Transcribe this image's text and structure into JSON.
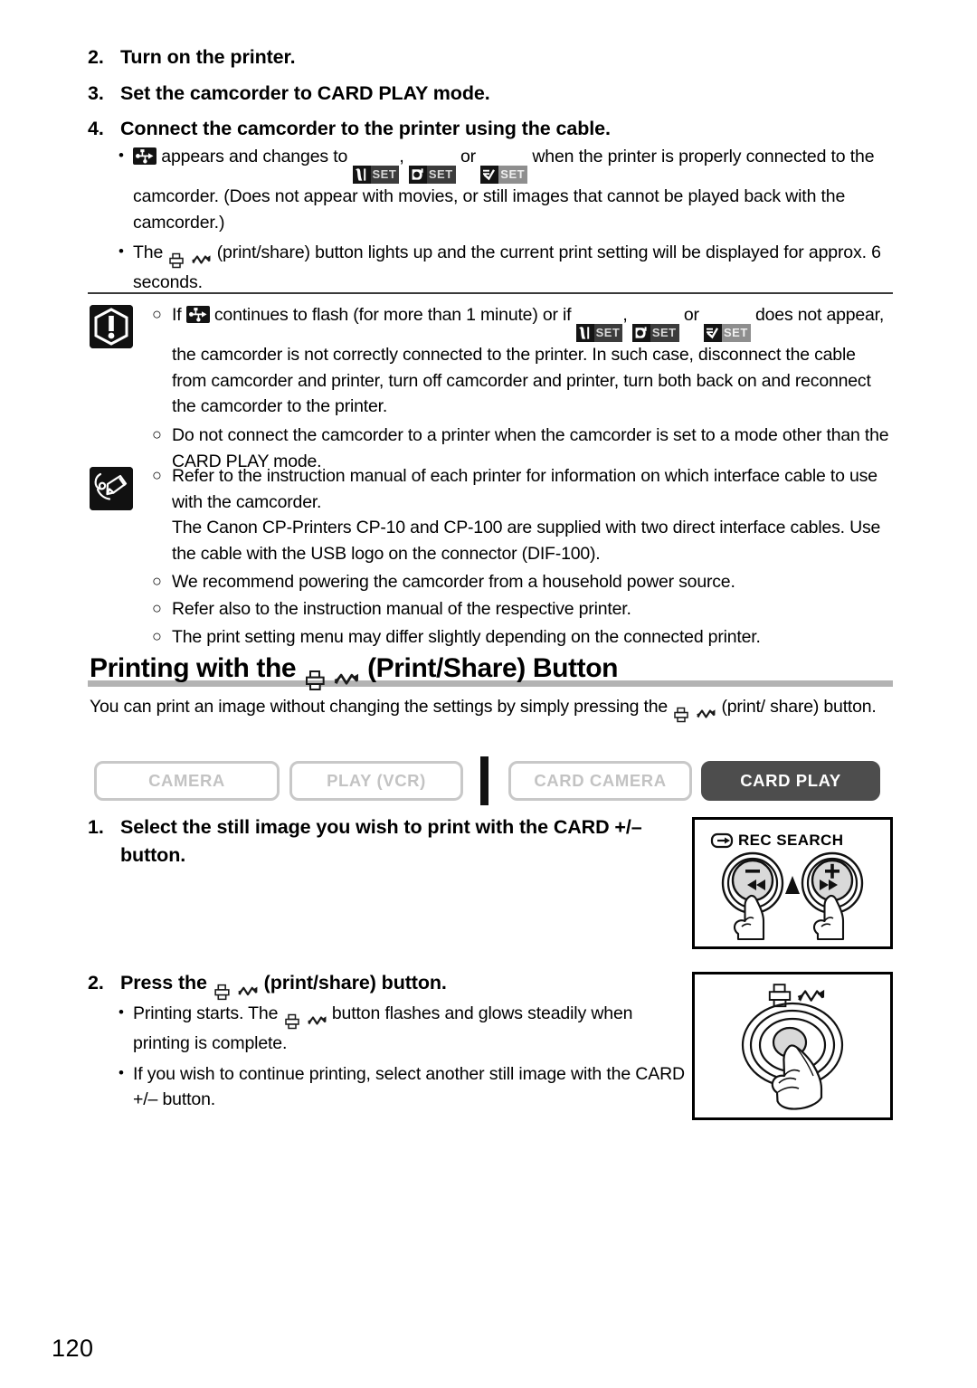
{
  "page": {
    "number": "120"
  },
  "steps_top": [
    {
      "n": "2.",
      "text": "Turn on the printer."
    },
    {
      "n": "3.",
      "text": "Set the camcorder to CARD PLAY mode."
    },
    {
      "n": "4.",
      "text": "Connect the camcorder to the printer using the cable."
    }
  ],
  "step4_bullets": [
    {
      "pre": "",
      "icon": "usb-icon",
      "mid_a": "appears and changes to",
      "badges": [
        "card-set-badge",
        "camera-set-badge",
        "check-set-badge"
      ],
      "sep1": ",",
      "sep2": "or",
      "post": "when the printer is properly connected to the camcorder. (Does not appear with movies, or still images that cannot be played back with the camcorder.)"
    },
    {
      "pre": "The",
      "icon": "print-share-icon",
      "post": "(print/share) button lights up and the current print setting will be displayed for approx. 6 seconds."
    }
  ],
  "caution": {
    "icon": "exclamation-icon",
    "items": [
      {
        "pre": "If",
        "icon": "usb-icon",
        "mid": "continues to flash (for more than 1 minute) or if",
        "badges": [
          "card-set-badge",
          "camera-set-badge",
          "check-set-badge"
        ],
        "sep1": ",",
        "sep2": "or",
        "post": "does not appear, the camcorder is not correctly connected to the printer. In such case, disconnect the cable from camcorder and printer, turn off camcorder and printer, turn both back on and reconnect the camcorder to the printer."
      },
      {
        "text": "Do not connect the camcorder to a printer when the camcorder is set to a mode other than the CARD PLAY mode."
      }
    ]
  },
  "note": {
    "icon": "pencil-note-icon",
    "items": [
      {
        "text": "Refer to the instruction manual of each printer for information on which interface cable to use with the camcorder.",
        "extra": "The Canon CP-Printers CP-10 and CP-100 are supplied with two direct interface cables. Use the cable with the USB logo on the connector (DIF-100)."
      },
      {
        "text": "We recommend powering the camcorder from a household power source."
      },
      {
        "text": "Refer also to the instruction manual of the respective printer."
      },
      {
        "text": "The print setting menu may differ slightly depending on the connected printer."
      }
    ]
  },
  "section": {
    "heading_pre": "Printing with the",
    "heading_icon": "print-share-icon",
    "heading_post": "(Print/Share) Button",
    "intro_pre": "You can print an image without changing the settings by simply pressing the",
    "intro_icon": "print-share-icon",
    "intro_post": "(print/ share) button."
  },
  "mode_tabs": [
    {
      "label": "CAMERA",
      "active": false
    },
    {
      "label": "PLAY (VCR)",
      "active": false
    },
    {
      "label": "CARD CAMERA",
      "active": false
    },
    {
      "label": "CARD PLAY",
      "active": true
    }
  ],
  "steps_body": [
    {
      "n": "1.",
      "text": "Select the still image you wish to print with the CARD +/– button.",
      "bullets": []
    },
    {
      "n": "2.",
      "pre": "Press the",
      "icon": "print-share-icon",
      "post": "(print/share) button.",
      "bullets": [
        {
          "pre": "Printing starts. The",
          "icon": "print-share-icon",
          "post": "button flashes and glows steadily when printing is complete."
        },
        {
          "text": "If you wish to continue printing, select another still image with the CARD +/– button."
        }
      ]
    }
  ],
  "figures": [
    {
      "name": "rec-search-figure",
      "label": "REC SEARCH",
      "label_icon": "rec-search-icon",
      "minus_label": "–",
      "plus_label": "+",
      "rew_icon": "rewind-icon",
      "ff_icon": "fast-forward-icon"
    },
    {
      "name": "print-share-button-figure",
      "icon": "print-share-icon",
      "hand_icon": "pointing-hand-icon"
    }
  ],
  "colors": {
    "tab_inactive_border": "#c8c8c8",
    "tab_inactive_text": "#c3c3c3",
    "tab_active_bg": "#4d4d4d",
    "heading_bar": "#b3b3b3",
    "rule": "#3a3a3a",
    "icon_bg": "#111111"
  }
}
